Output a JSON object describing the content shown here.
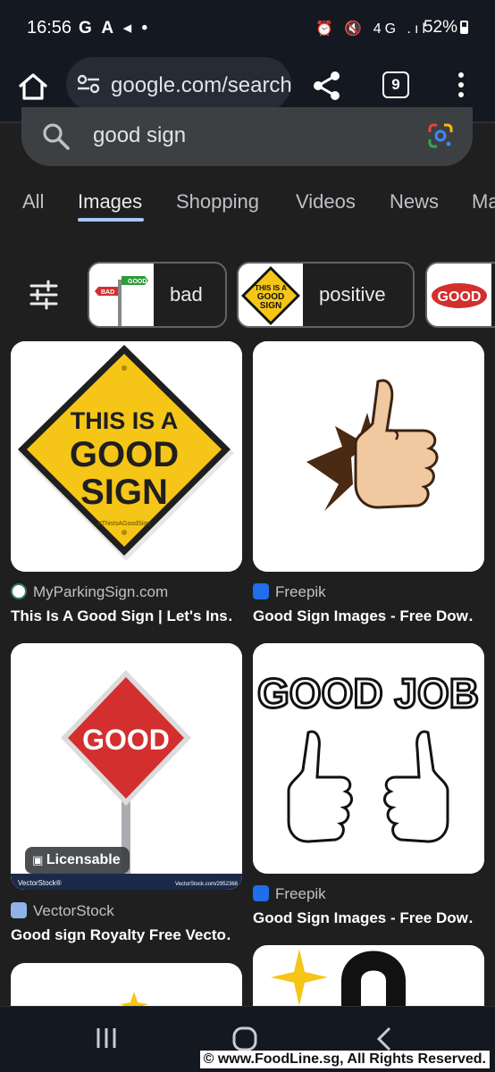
{
  "status_bar": {
    "time": "16:56",
    "left_icons": "G A ◂ •",
    "right_icons": "⏰ 🔇 4G .ıl",
    "battery": "52%"
  },
  "browser": {
    "url": "google.com/search",
    "tab_count": "9"
  },
  "search": {
    "query": "good sign"
  },
  "tabs": [
    "All",
    "Images",
    "Shopping",
    "Videos",
    "News",
    "Maps"
  ],
  "active_tab": "Images",
  "chips": [
    {
      "label": "bad",
      "thumb_text": "GOOD / BAD"
    },
    {
      "label": "positive",
      "thumb_text": "THIS IS A GOOD SIGN"
    },
    {
      "label": "",
      "thumb_text": "GOOD"
    }
  ],
  "results": [
    {
      "source": "MyParkingSign.com",
      "title": "This Is A Good Sign | Let's Ins…",
      "image_text": [
        "THIS IS A",
        "GOOD",
        "SIGN"
      ],
      "image_caption": "#ThisIsAGoodSign"
    },
    {
      "source": "Freepik",
      "title": "Good Sign Images - Free Dow…"
    },
    {
      "source": "VectorStock",
      "title": "Good sign Royalty Free Vecto…",
      "image_text": "GOOD",
      "badge": "Licensable",
      "footer_left": "VectorStock®",
      "footer_right": "VectorStock.com/2952368"
    },
    {
      "source": "Freepik",
      "title": "Good Sign Images - Free Dow…",
      "image_text": "GOOD JOB"
    }
  ],
  "watermark": "© www.FoodLine.sg, All Rights Reserved.",
  "colors": {
    "background": "#1f1f1f",
    "bar": "#141820",
    "accent": "#a8c7fa",
    "sign_yellow": "#f5c518",
    "sign_red": "#d32f2f"
  }
}
